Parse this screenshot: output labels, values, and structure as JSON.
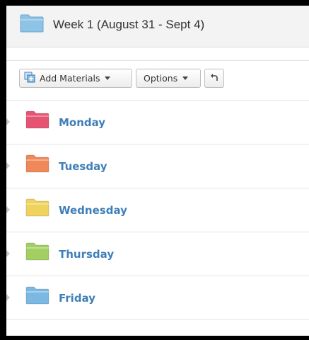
{
  "header": {
    "title": "Week 1 (August 31 - Sept 4)",
    "folder_icon": "folder-icon",
    "folder_color": "#8fc3e6"
  },
  "toolbar": {
    "add_materials_label": "Add Materials",
    "options_label": "Options",
    "add_materials_icon": "add-materials-icon",
    "back_icon": "undo-arrow-icon"
  },
  "folders": [
    {
      "label": "Monday",
      "color": "#e55573"
    },
    {
      "label": "Tuesday",
      "color": "#f0895a"
    },
    {
      "label": "Wednesday",
      "color": "#f0d35e"
    },
    {
      "label": "Thursday",
      "color": "#a3cf62"
    },
    {
      "label": "Friday",
      "color": "#7bb9e3"
    }
  ],
  "colors": {
    "link": "#3f7fb8",
    "header_bg": "#f3f3f3"
  }
}
